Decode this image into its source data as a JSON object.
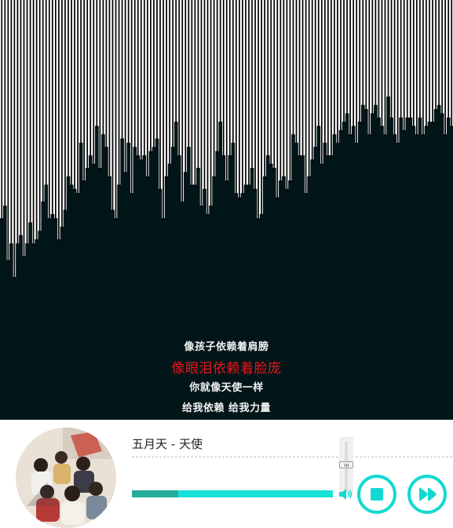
{
  "colors": {
    "visualizer_dark": "#021619",
    "visualizer_stripe": "#000000",
    "lyric_current": "#e8161a",
    "lyric_normal": "#f2f2f2",
    "accent": "#12d9d2",
    "progress_played": "#23ad9a",
    "progress_remaining": "#17e0d6"
  },
  "visualizer": {
    "levels": [
      0.48,
      0.51,
      0.38,
      0.42,
      0.34,
      0.42,
      0.44,
      0.39,
      0.42,
      0.47,
      0.42,
      0.43,
      0.45,
      0.52,
      0.56,
      0.48,
      0.49,
      0.48,
      0.43,
      0.46,
      0.5,
      0.58,
      0.56,
      0.55,
      0.54,
      0.66,
      0.57,
      0.6,
      0.63,
      0.61,
      0.7,
      0.6,
      0.68,
      0.65,
      0.58,
      0.5,
      0.48,
      0.56,
      0.67,
      0.59,
      0.66,
      0.54,
      0.65,
      0.63,
      0.62,
      0.63,
      0.58,
      0.64,
      0.65,
      0.67,
      0.55,
      0.48,
      0.58,
      0.61,
      0.65,
      0.71,
      0.63,
      0.52,
      0.59,
      0.65,
      0.56,
      0.56,
      0.6,
      0.51,
      0.55,
      0.49,
      0.51,
      0.58,
      0.64,
      0.71,
      0.63,
      0.57,
      0.63,
      0.66,
      0.54,
      0.53,
      0.54,
      0.56,
      0.56,
      0.6,
      0.55,
      0.48,
      0.49,
      0.58,
      0.63,
      0.61,
      0.6,
      0.53,
      0.57,
      0.58,
      0.55,
      0.57,
      0.68,
      0.66,
      0.63,
      0.63,
      0.54,
      0.58,
      0.62,
      0.65,
      0.7,
      0.61,
      0.66,
      0.63,
      0.63,
      0.68,
      0.66,
      0.69,
      0.71,
      0.73,
      0.68,
      0.7,
      0.66,
      0.71,
      0.75,
      0.74,
      0.68,
      0.73,
      0.75,
      0.72,
      0.7,
      0.68,
      0.77,
      0.72,
      0.68,
      0.66,
      0.72,
      0.69,
      0.72,
      0.72,
      0.7,
      0.68,
      0.72,
      0.68,
      0.7,
      0.71,
      0.71,
      0.74,
      0.75,
      0.73,
      0.68,
      0.72,
      0.7
    ]
  },
  "lyrics": {
    "previous": "像孩子依赖着肩膀",
    "current": "像眼泪依赖着脸庞",
    "next_1": "你就像天使一样",
    "next_2": "给我依赖 给我力量"
  },
  "player": {
    "title": "五月天 - 天使",
    "cover_icon": "album-cover",
    "progress": 0.23,
    "volume": 0.55,
    "speaker_icon": "speaker-icon",
    "stop_icon": "stop-icon",
    "next_icon": "fast-forward-icon"
  }
}
